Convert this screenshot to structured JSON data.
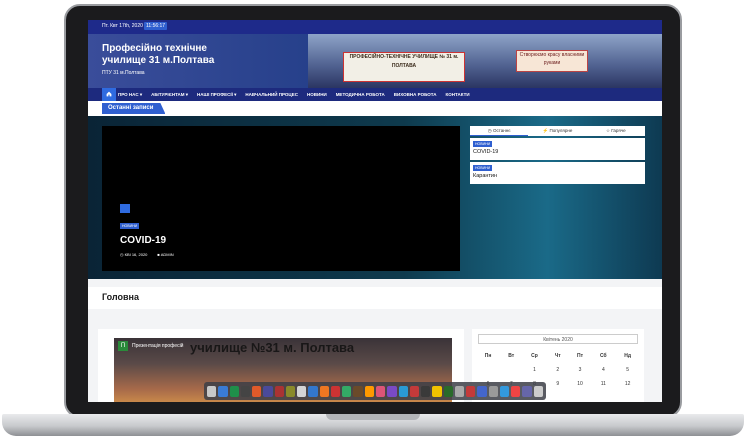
{
  "topbar": {
    "date": "Пт. Квт 17th, 2020",
    "time": "11:56:17"
  },
  "header": {
    "site_title": "Професійно технічне училище 31 м.Полтава",
    "site_subtitle": "ПТУ 31 м.Полтава",
    "sign_text": "ПРОФЕСІЙНО-ТЕХНІЧНЕ УЧИЛИЩЕ № 31 м. ПОЛТАВА",
    "sign2_text": "Створюємо красу власними руками"
  },
  "nav": {
    "items": [
      "ПРО НАС ▾",
      "АБІТУРІЄНТАМ ▾",
      "НАШІ ПРОФЕСІЇ ▾",
      "НАВЧАЛЬНИЙ ПРОЦЕС",
      "НОВИНИ",
      "МЕТОДИЧНА РОБОТА",
      "ВИХОВНА РОБОТА",
      "КОНТАКТИ"
    ]
  },
  "latest": {
    "label": "Останні записи"
  },
  "feature": {
    "category": "НОВИНИ",
    "title": "COVID-19",
    "date": "КВІ 16, 2020",
    "author": "ADMIN"
  },
  "tabs": [
    "Останнє",
    "Популярне",
    "Гаряче"
  ],
  "cards": [
    {
      "category": "НОВИНИ",
      "title": "COVID-19"
    },
    {
      "category": "НОВИНИ",
      "title": "Карантин"
    }
  ],
  "section": {
    "title": "Головна"
  },
  "video": {
    "avatar": "П",
    "title": "Презентація професій",
    "overlay": "училище №31 м. Полтава"
  },
  "calendar": {
    "month": "Квітень 2020",
    "weekdays": [
      "Пн",
      "Вт",
      "Ср",
      "Чт",
      "Пт",
      "Сб",
      "Нд"
    ],
    "rows": [
      [
        "",
        "",
        "1",
        "2",
        "3",
        "4",
        "5"
      ],
      [
        "6",
        "7",
        "8",
        "9",
        "10",
        "11",
        "12"
      ]
    ]
  },
  "dock_colors": [
    "#c8c8c8",
    "#3a7bd5",
    "#1f8f4a",
    "#444",
    "#e05a2a",
    "#4a4a9a",
    "#aa3333",
    "#8a8a2a",
    "#d4d4d4",
    "#3377cc",
    "#ee7722",
    "#cc3333",
    "#33aa66",
    "#6a4a2a",
    "#ff9900",
    "#dd5577",
    "#7a4ac4",
    "#2a9ad4",
    "#c43a3a",
    "#3a3a3a",
    "#f2c200",
    "#2a6a2a",
    "#aaaaaa",
    "#c43a3a",
    "#4466cc",
    "#9a9a9a",
    "#3399dd",
    "#ee4444",
    "#6666aa",
    "#cccccc"
  ]
}
